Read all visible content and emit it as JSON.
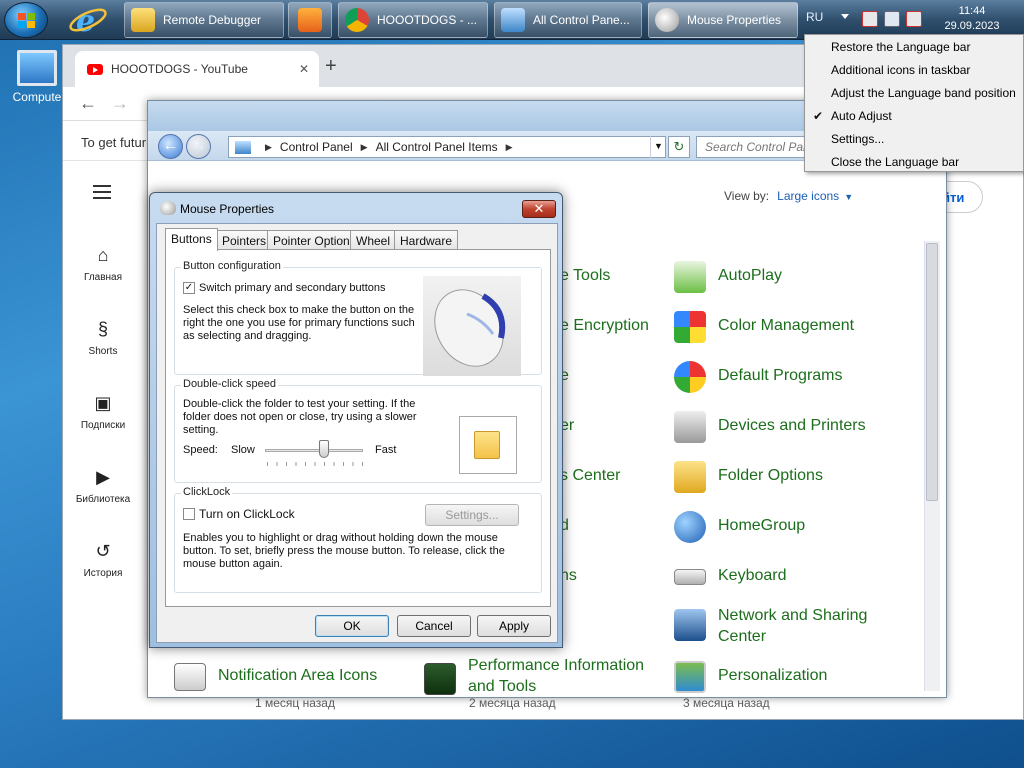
{
  "taskbar": {
    "buttons": [
      "Remote Debugger",
      "HOOOTDOGS - ...",
      "All Control Pane...",
      "Mouse Properties"
    ],
    "language": "RU",
    "time": "11:44",
    "date": "29.09.2023"
  },
  "desktop": {
    "icon_label": "Compute"
  },
  "browser": {
    "tab_title": "HOOOTDOGS - YouTube",
    "infobar_text": "To get futur",
    "sidebar": [
      "Главная",
      "Shorts",
      "Подписки",
      "Библиотека",
      "История"
    ],
    "login_label": "йти",
    "video_ages": [
      "1 месяц назад",
      "2 месяца назад",
      "3 месяца назад"
    ]
  },
  "control_panel": {
    "breadcrumb": [
      "Control Panel",
      "All Control Panel Items"
    ],
    "search_placeholder": "Search Control Panel",
    "view_by_label": "View by:",
    "view_by_value": "Large icons",
    "items_left_partial": [
      "e Tools",
      "e Encryption",
      "e",
      "er",
      "s Center",
      "d",
      "ns"
    ],
    "items_right": [
      "AutoPlay",
      "Color Management",
      "Default Programs",
      "Devices and Printers",
      "Folder Options",
      "HomeGroup",
      "Keyboard",
      "Network and Sharing Center",
      "Personalization"
    ],
    "bottom_items": [
      "Notification Area Icons",
      "Performance Information and Tools"
    ]
  },
  "language_menu": {
    "items": [
      "Restore the Language bar",
      "Additional icons in taskbar",
      "Adjust the Language band position",
      "Auto Adjust",
      "Settings...",
      "Close the Language bar"
    ]
  },
  "mouse_properties": {
    "title": "Mouse Properties",
    "tabs": [
      "Buttons",
      "Pointers",
      "Pointer Options",
      "Wheel",
      "Hardware"
    ],
    "button_config": {
      "label": "Button configuration",
      "checkbox_label": "Switch primary and secondary buttons",
      "description": "Select this check box to make the button on the right the one you use for primary functions such as selecting and dragging."
    },
    "double_click": {
      "label": "Double-click speed",
      "description": "Double-click the folder to test your setting. If the folder does not open or close, try using a slower setting.",
      "speed_label": "Speed:",
      "slow": "Slow",
      "fast": "Fast",
      "speed_value": 0.6
    },
    "clicklock": {
      "label": "ClickLock",
      "checkbox_label": "Turn on ClickLock",
      "settings_button": "Settings...",
      "description": "Enables you to highlight or drag without holding down the mouse button. To set, briefly press the mouse button. To release, click the mouse button again."
    },
    "buttons": {
      "ok": "OK",
      "cancel": "Cancel",
      "apply": "Apply"
    }
  },
  "colors": {
    "accent": "#1c6e1c",
    "link": "#1a5fb4",
    "titlebar": "#aac7e4"
  }
}
